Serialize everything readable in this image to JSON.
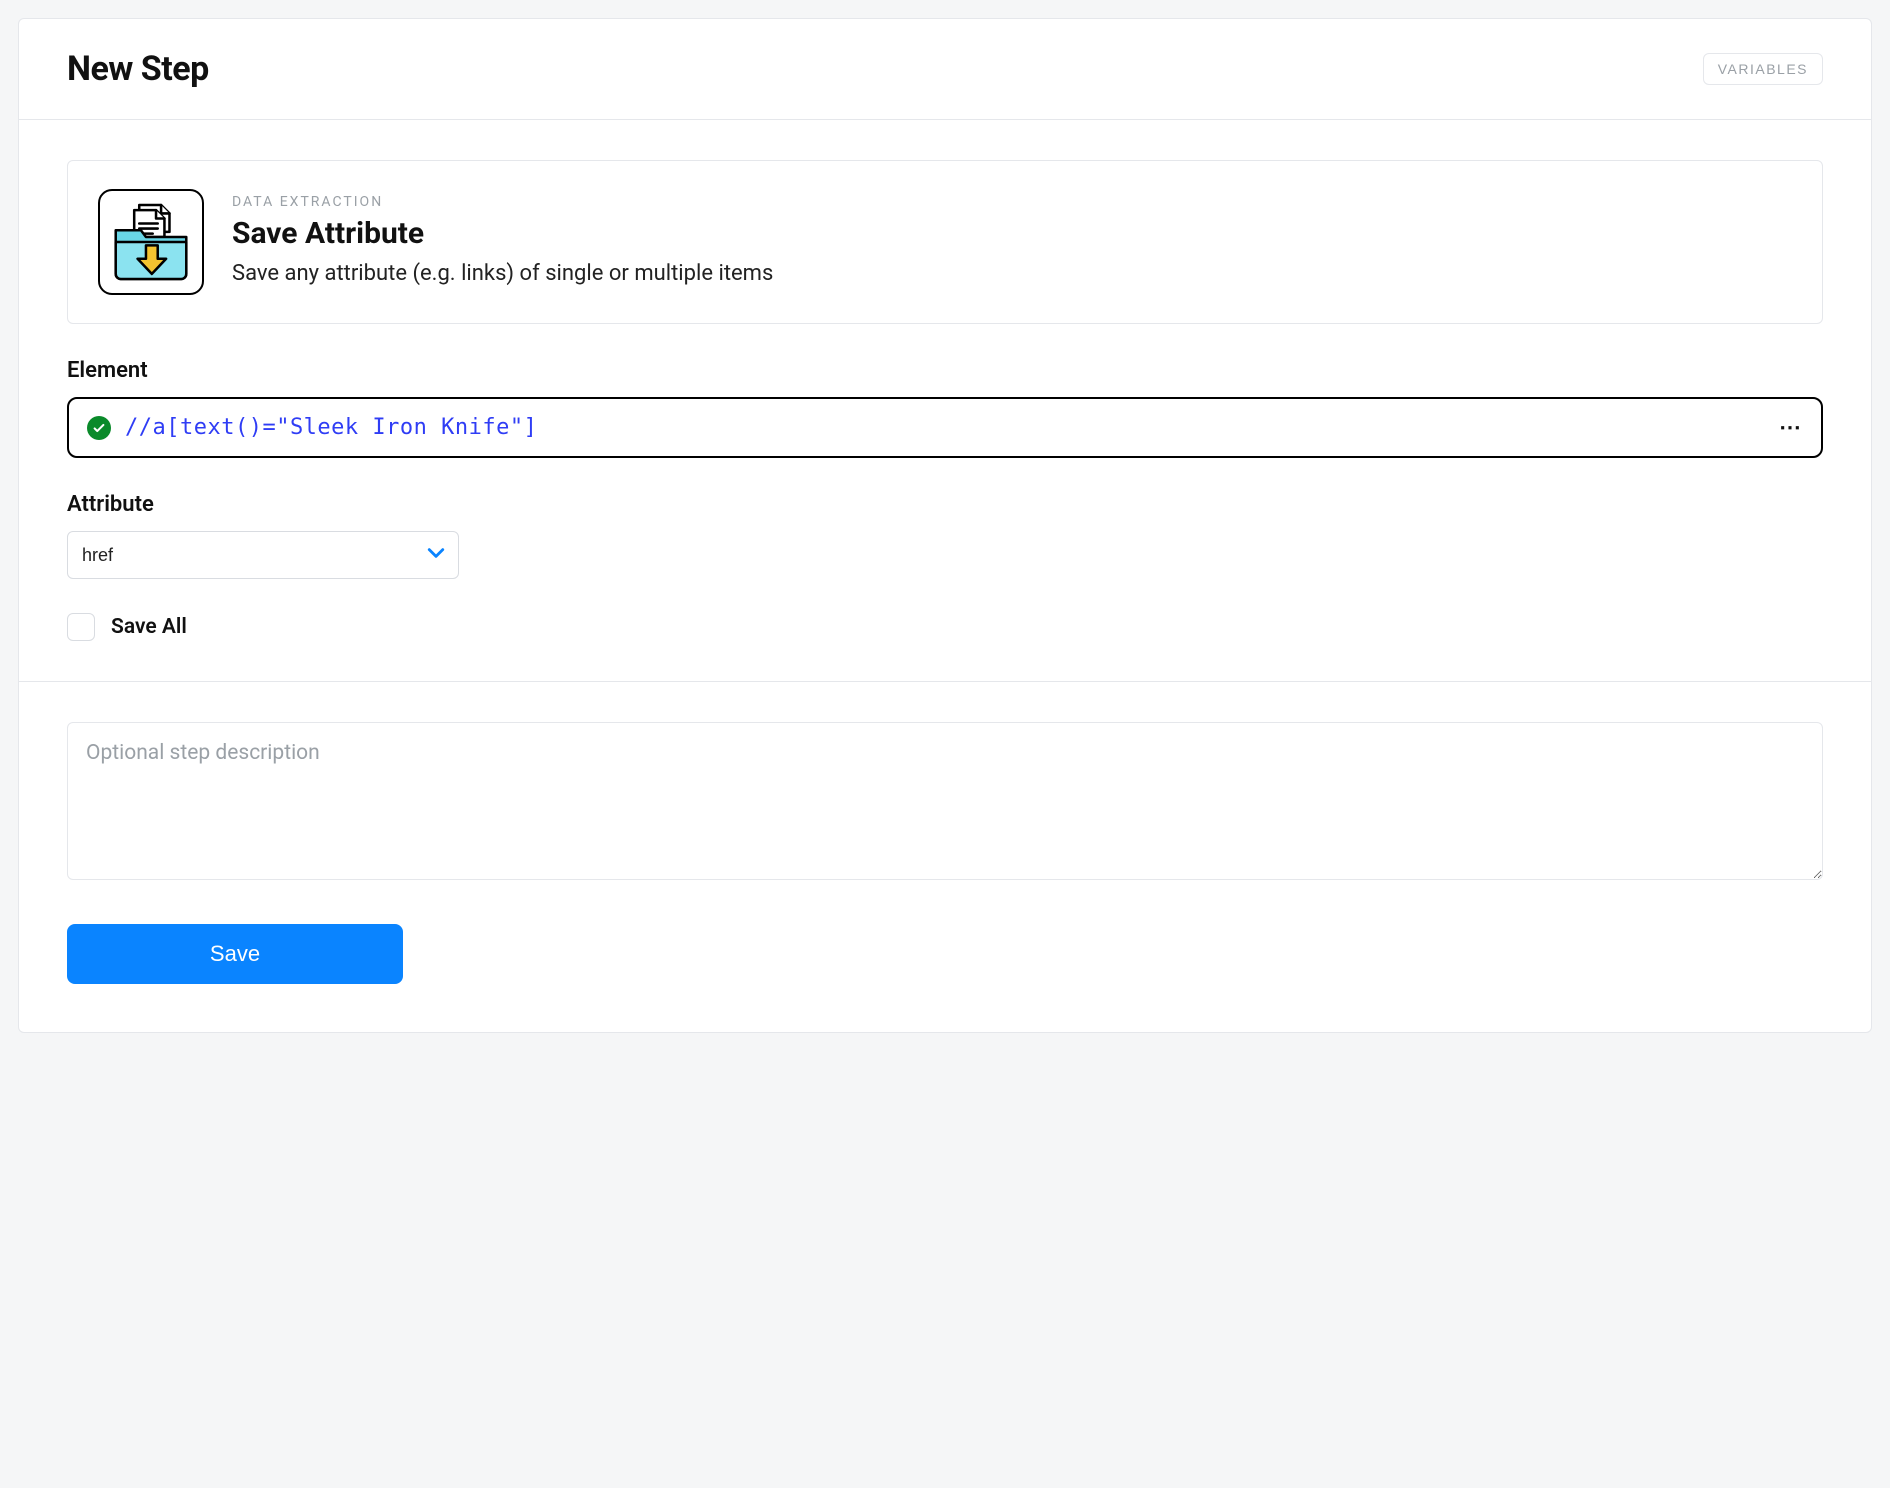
{
  "header": {
    "title": "New Step",
    "variables_btn": "VARIABLES"
  },
  "step_card": {
    "eyebrow": "DATA EXTRACTION",
    "title": "Save Attribute",
    "description": "Save any attribute (e.g. links) of single or multiple items",
    "icon": "folder-download-icon"
  },
  "element": {
    "label": "Element",
    "value": "//a[text()=\"Sleek Iron Knife\"]",
    "status": "valid"
  },
  "attribute": {
    "label": "Attribute",
    "selected": "href"
  },
  "save_all": {
    "label": "Save All",
    "checked": false
  },
  "description": {
    "placeholder": "Optional step description",
    "value": ""
  },
  "actions": {
    "save": "Save"
  }
}
